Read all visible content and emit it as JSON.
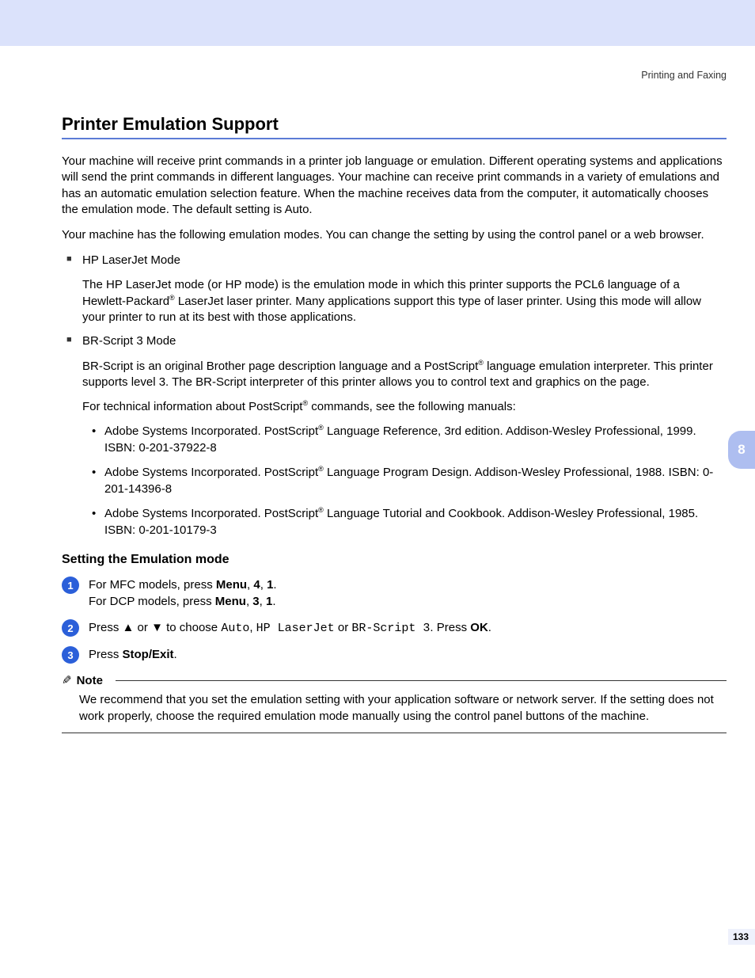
{
  "header": "Printing and Faxing",
  "title": "Printer Emulation Support",
  "para1": "Your machine will receive print commands in a printer job language or emulation. Different operating systems and applications will send the print commands in different languages. Your machine can receive print commands in a variety of emulations and has an automatic emulation selection feature. When the machine receives data from the computer, it automatically chooses the emulation mode. The default setting is Auto.",
  "para2": "Your machine has the following emulation modes. You can change the setting by using the control panel or a web browser.",
  "mode1_title": "HP LaserJet Mode",
  "mode1_body_a": "The HP LaserJet mode (or HP mode) is the emulation mode in which this printer supports the PCL6 language of a Hewlett-Packard",
  "mode1_body_b": " LaserJet laser printer. Many applications support this type of laser printer. Using this mode will allow your printer to run at its best with those applications.",
  "mode2_title": "BR-Script 3 Mode",
  "mode2_body_a": "BR-Script is an original Brother page description language and a PostScript",
  "mode2_body_b": " language emulation interpreter. This printer supports level 3. The BR-Script interpreter of this printer allows you to control text and graphics on the page.",
  "mode2_info_a": "For technical information about PostScript",
  "mode2_info_b": " commands, see the following manuals:",
  "ref1_a": "Adobe Systems Incorporated. PostScript",
  "ref1_b": " Language Reference, 3rd edition. Addison-Wesley Professional, 1999. ISBN: 0-201-37922-8",
  "ref2_a": "Adobe Systems Incorporated. PostScript",
  "ref2_b": " Language Program Design. Addison-Wesley Professional, 1988. ISBN: 0-201-14396-8",
  "ref3_a": "Adobe Systems Incorporated. PostScript",
  "ref3_b": " Language Tutorial and Cookbook. Addison-Wesley Professional, 1985. ISBN: 0-201-10179-3",
  "reg": "®",
  "subheading": "Setting the Emulation mode",
  "step1_a": "For MFC models, press ",
  "step1_menu": "Menu",
  "step1_b": ", ",
  "step1_c": "4",
  "step1_d": "1",
  "step1_dot": ".",
  "step1_line2_a": "For DCP models, press ",
  "step1_line2_c": "3",
  "step2_a": "Press ",
  "step2_up": "▲",
  "step2_or": " or ",
  "step2_down": "▼",
  "step2_b": " to choose ",
  "step2_auto": "Auto",
  "step2_comma": ", ",
  "step2_hp": "HP LaserJet",
  "step2_or2": " or ",
  "step2_br": "BR-Script 3",
  "step2_c": ". Press ",
  "step2_ok": "OK",
  "step3_a": "Press ",
  "step3_stop": "Stop/Exit",
  "note_icon": "✎",
  "note_label": "Note",
  "note_body": "We recommend that you set the emulation setting with your application software or network server. If the setting does not work properly, choose the required emulation mode manually using the control panel buttons of the machine.",
  "chapter": "8",
  "page_no": "133"
}
